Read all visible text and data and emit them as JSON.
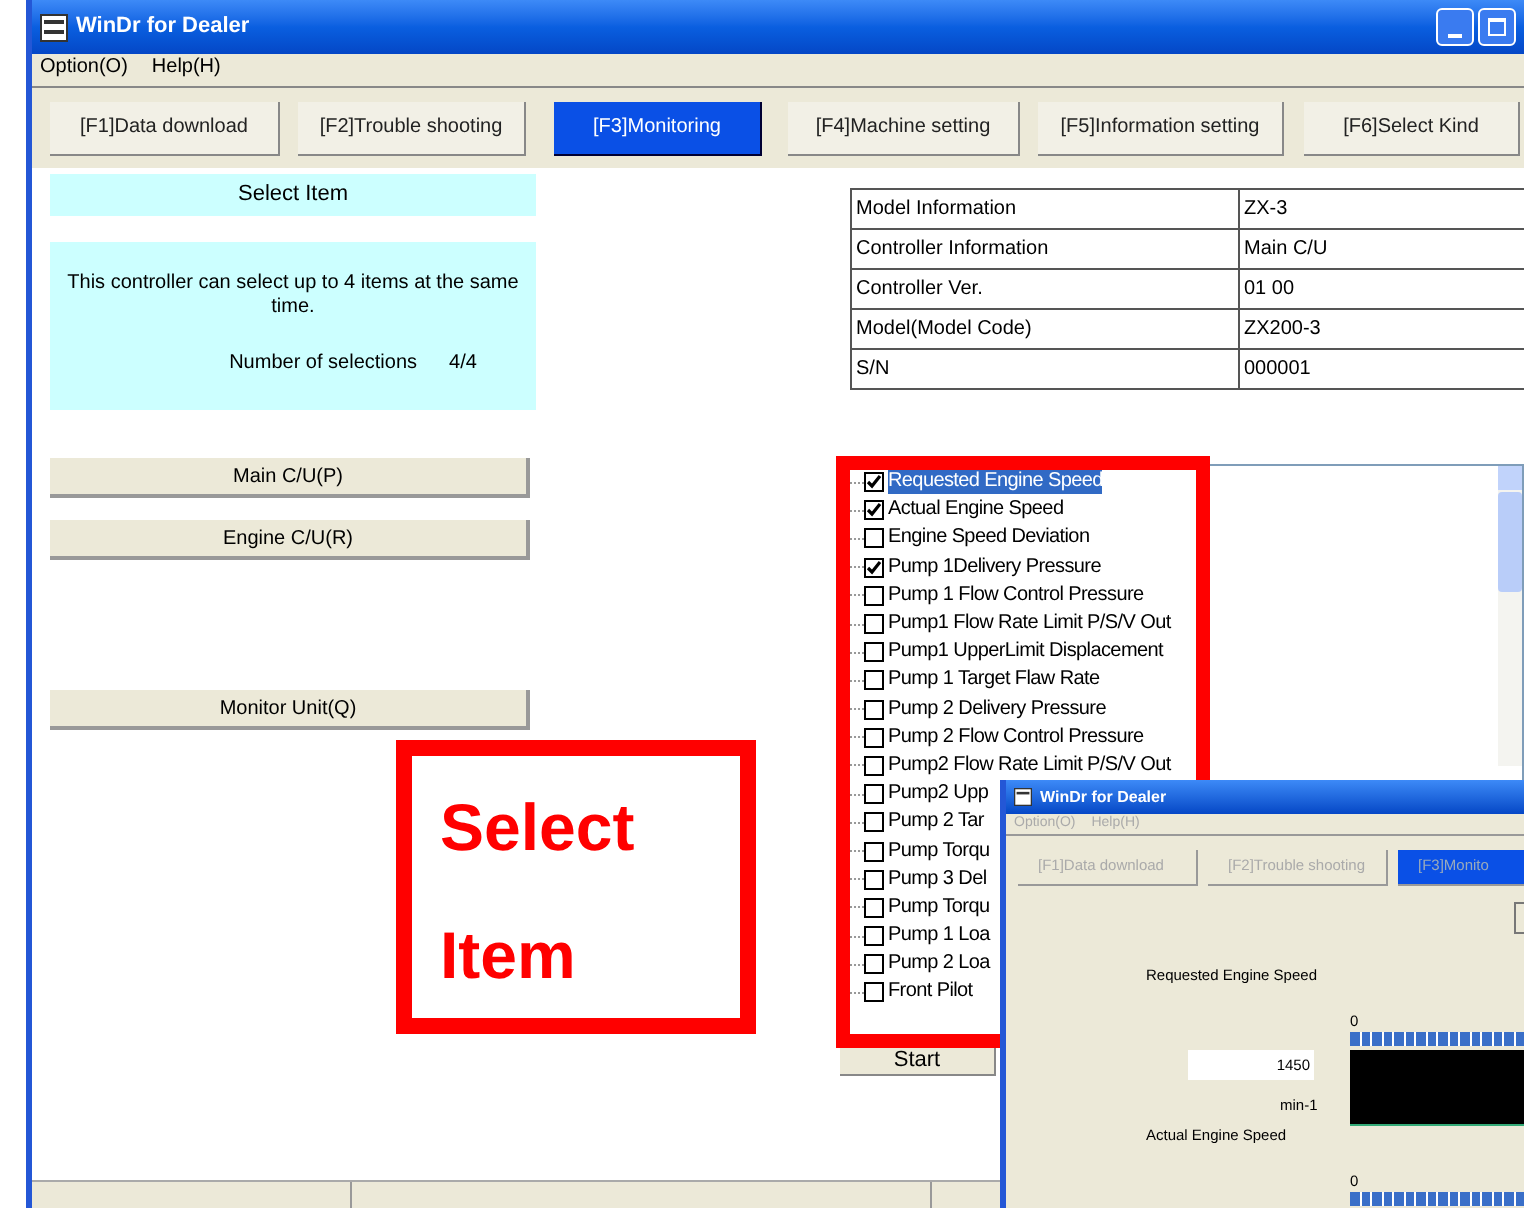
{
  "window": {
    "title": "WinDr for Dealer"
  },
  "menu": [
    "Option(O)",
    "Help(H)"
  ],
  "tabs": [
    {
      "label": "[F1]Data download",
      "selected": false
    },
    {
      "label": "[F2]Trouble shooting",
      "selected": false
    },
    {
      "label": "[F3]Monitoring",
      "selected": true
    },
    {
      "label": "[F4]Machine setting",
      "selected": false
    },
    {
      "label": "[F5]Information setting",
      "selected": false
    },
    {
      "label": "[F6]Select Kind",
      "selected": false
    }
  ],
  "select_panel": {
    "title": "Select Item",
    "message": "This controller can select up to 4 items at the same time.",
    "count_label": "Number of selections",
    "count_value": "4/4"
  },
  "controllers": [
    "Main C/U(P)",
    "Engine C/U(R)",
    "Monitor Unit(Q)"
  ],
  "info_table": [
    {
      "label": "Model Information",
      "value": "ZX-3"
    },
    {
      "label": "Controller Information",
      "value": "Main C/U"
    },
    {
      "label": "Controller Ver.",
      "value": "01 00"
    },
    {
      "label": "Model(Model Code)",
      "value": "ZX200-3"
    },
    {
      "label": "S/N",
      "value": "000001"
    }
  ],
  "items": [
    {
      "label": "Requested Engine Speed",
      "checked": true,
      "selected": true
    },
    {
      "label": "Actual Engine Speed",
      "checked": true,
      "selected": false
    },
    {
      "label": "Engine Speed Deviation",
      "checked": false,
      "selected": false
    },
    {
      "label": "Pump 1Delivery Pressure",
      "checked": true,
      "selected": false
    },
    {
      "label": "Pump 1 Flow Control Pressure",
      "checked": false,
      "selected": false
    },
    {
      "label": "Pump1 Flow Rate Limit P/S/V Out",
      "checked": false,
      "selected": false
    },
    {
      "label": "Pump1 UpperLimit Displacement",
      "checked": false,
      "selected": false
    },
    {
      "label": "Pump 1 Target Flaw Rate",
      "checked": false,
      "selected": false
    },
    {
      "label": "Pump 2 Delivery Pressure",
      "checked": false,
      "selected": false
    },
    {
      "label": "Pump 2 Flow Control Pressure",
      "checked": false,
      "selected": false
    },
    {
      "label": "Pump2 Flow Rate Limit P/S/V Out",
      "checked": false,
      "selected": false
    },
    {
      "label": "Pump2 Upp",
      "checked": false,
      "selected": false
    },
    {
      "label": "Pump 2 Tar",
      "checked": false,
      "selected": false
    },
    {
      "label": "Pump Torqu",
      "checked": false,
      "selected": false
    },
    {
      "label": "Pump 3 Del",
      "checked": false,
      "selected": false
    },
    {
      "label": "Pump Torqu",
      "checked": false,
      "selected": false
    },
    {
      "label": "Pump 1 Loa",
      "checked": false,
      "selected": false
    },
    {
      "label": "Pump 2 Loa",
      "checked": false,
      "selected": false
    },
    {
      "label": "Front Pilot",
      "checked": false,
      "selected": false
    }
  ],
  "start_button": "Start",
  "annotation": [
    "Select",
    "Item"
  ],
  "monitor_window": {
    "title": "WinDr for Dealer",
    "menu": [
      "Option(O)",
      "Help(H)"
    ],
    "tabs": [
      {
        "label": "[F1]Data download",
        "selected": false
      },
      {
        "label": "[F2]Trouble shooting",
        "selected": false
      },
      {
        "label": "[F3]Monito",
        "selected": true
      }
    ],
    "readings": [
      {
        "label": "Requested Engine Speed",
        "scale_start": "0",
        "value": "1450",
        "unit": "min-1"
      },
      {
        "label": "Actual Engine Speed",
        "scale_start": "0"
      }
    ]
  }
}
